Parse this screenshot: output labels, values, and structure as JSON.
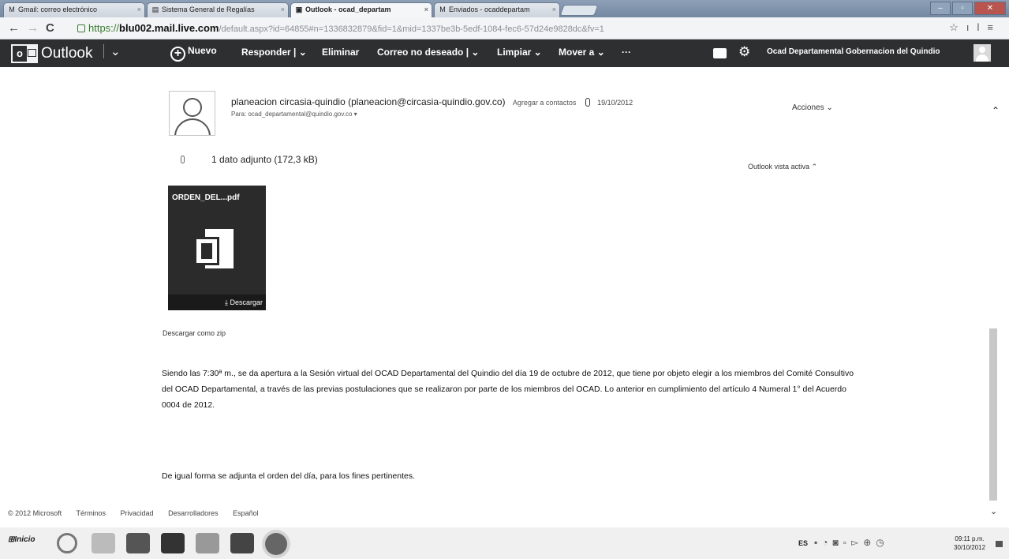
{
  "browser": {
    "tabs": [
      {
        "label": "Gmail: correo electrónico",
        "icon": "gmail-icon"
      },
      {
        "label": "Sistema General de Regalías",
        "icon": "sgr-icon"
      },
      {
        "label": "Outlook - ocad_departam",
        "icon": "outlook-icon",
        "active": true
      },
      {
        "label": "Enviados - ocaddepartam",
        "icon": "gmail-icon"
      }
    ],
    "url_scheme": "https://",
    "url_host": "blu002.mail.live.com",
    "url_rest": "/default.aspx?id=64855#n=1336832879&fid=1&mid=1337be3b-5edf-1084-fec6-57d24e9828dc&fv=1"
  },
  "outlook": {
    "app_name": "Outlook",
    "commands": {
      "nuevo": "Nuevo",
      "responder": "Responder",
      "eliminar": "Eliminar",
      "correo_no_deseado": "Correo no deseado",
      "limpiar": "Limpiar",
      "mover_a": "Mover a",
      "more": "···"
    },
    "account_name": "Ocad Departamental Gobernacion del Quindio"
  },
  "message": {
    "sender": "planeacion circasia-quindio (planeacion@circasia-quindio.gov.co)",
    "add_contact": "Agregar a contactos",
    "date": "19/10/2012",
    "to_label": "Para:",
    "to": "ocad_departamental@quindio.gov.co",
    "actions": "Acciones",
    "attachment_summary": "1 dato adjunto (172,3 kB)",
    "active_view": "Outlook vista activa",
    "attachment_name": "ORDEN_DEL...pdf",
    "download": "Descargar",
    "download_zip": "Descargar como zip",
    "body_paragraph_1": "Siendo las 7:30ª m., se da apertura a la Sesión virtual del OCAD Departamental del Quindio del día 19 de octubre de 2012, que tiene por objeto elegir a los miembros del Comité Consultivo del OCAD Departamental, a través de las previas postulaciones que se realizaron por parte de los miembros del OCAD. Lo anterior en cumplimiento del artículo 4 Numeral 1° del Acuerdo 0004 de 2012.",
    "body_paragraph_2": "De igual forma se adjunta el orden del día, para los fines pertinentes."
  },
  "footer": {
    "copyright": "© 2012 Microsoft",
    "terms": "Términos",
    "privacy": "Privacidad",
    "developers": "Desarrolladores",
    "language": "Español"
  },
  "taskbar": {
    "start": "Inicio",
    "lang": "ES",
    "time": "09:11 p.m.",
    "date": "30/10/2012"
  }
}
